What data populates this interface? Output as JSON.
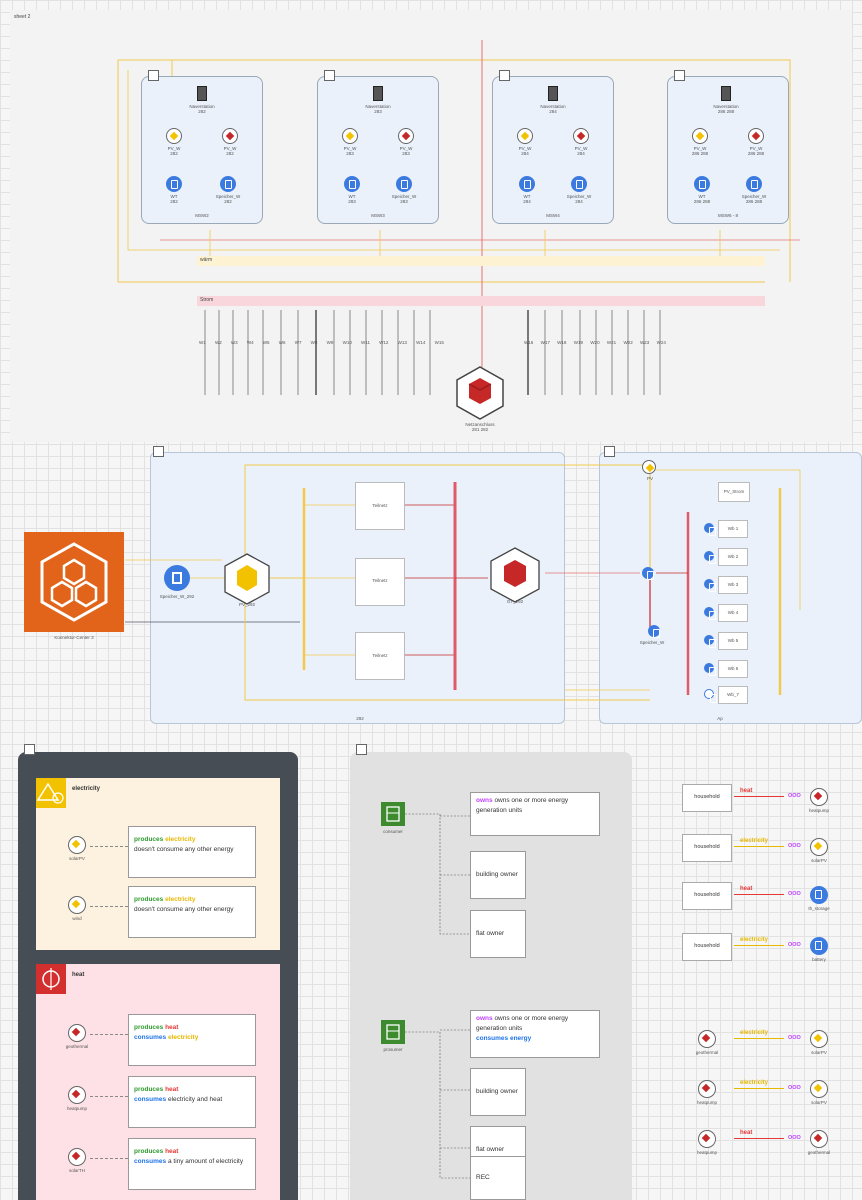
{
  "top": {
    "title": "sheet 2",
    "buildings": [
      {
        "rack": "Naverstation\n282",
        "pv": "PV_W\n282",
        "hp": "PV_W\n282",
        "inv": "WT\n282",
        "store": "Speicher_W\n282",
        "foot": "MSW2"
      },
      {
        "rack": "Naverstation\n283",
        "pv": "PV_W\n283",
        "hp": "PV_W\n283",
        "inv": "WT\n283",
        "store": "Speicher_W\n283",
        "foot": "MSW3"
      },
      {
        "rack": "Naverstation\n284",
        "pv": "PV_W\n284",
        "hp": "PV_W\n284",
        "inv": "WT\n284",
        "store": "Speicher_W\n284",
        "foot": "MSW4"
      },
      {
        "rack": "Naverstation\n286 288",
        "pv": "PV_W\n286 288",
        "hp": "PV_W\n286 288",
        "inv": "WT\n286 288",
        "store": "Speicher_W\n286 288",
        "foot": "MSW6 - 8"
      }
    ],
    "bus_yellow": "wärm",
    "bus_pink": "Strom",
    "center_label": "Netzanschluss\n281 282",
    "feeder_nums_left": [
      "W1",
      "W2",
      "W3",
      "W4",
      "W5",
      "W6",
      "W7",
      "W8",
      "W9",
      "W10",
      "W11",
      "W12",
      "W13",
      "W14",
      "W15"
    ],
    "feeder_nums_right": [
      "W16",
      "W17",
      "W18",
      "W19",
      "W20",
      "W21",
      "W22",
      "W23",
      "W24"
    ]
  },
  "middle": {
    "orange_label": "Konnektor-Center 3",
    "storage_label": "Speicher_W_292",
    "hub_label": "PV_292",
    "boxes": [
      "Teilnetz",
      "Teilnetz",
      "Teilnetz"
    ],
    "red_hub_label": "GT_292",
    "right_top_label": "PV_Strom",
    "right_items": [
      "Wb 1",
      "Wb 2",
      "Wb 3",
      "Wb 4",
      "Wb 5",
      "Wb 6"
    ],
    "right_bottom": "Wb_7",
    "bottom_left_label": "292",
    "bottom_right_label": "Ap",
    "left_hub_label": "Speicher_W"
  },
  "legend": {
    "electricity": "electricity",
    "heat": "heat",
    "items": [
      {
        "name": "solarPV",
        "produces": "electricity",
        "consumes": "doesn't consume any other energy"
      },
      {
        "name": "wind",
        "produces": "electricity",
        "consumes": "doesn't consume any other energy"
      },
      {
        "name": "geothermal",
        "produces": "heat",
        "consumes": "electricity"
      },
      {
        "name": "heatpump",
        "produces": "heat",
        "consumes": "electricity and heat"
      },
      {
        "name": "solarTH",
        "produces": "heat",
        "consumes": "a tiny amount of electricity"
      }
    ]
  },
  "roles": {
    "consumer": "consumer",
    "prosumer": "prosumer",
    "consumer_desc": "owns one or more energy generation units",
    "prosumer_desc": "owns one or more energy generation units",
    "prosumer_desc2": "consumes energy",
    "branches1": [
      "building owner",
      "flat owner"
    ],
    "branches2": [
      "building owner",
      "flat owner",
      "REC"
    ]
  },
  "flows": [
    {
      "from": "household",
      "energy": "heat",
      "to": "heatpump"
    },
    {
      "from": "household",
      "energy": "electricity",
      "to": "solarPV"
    },
    {
      "from": "household",
      "energy": "heat",
      "to": "th_storage"
    },
    {
      "from": "household",
      "energy": "electricity",
      "to": "battery"
    },
    {
      "from": "geothermal",
      "energy": "electricity",
      "to": "solarPV"
    },
    {
      "from": "heatpump",
      "energy": "electricity",
      "to": "solarPV"
    },
    {
      "from": "heatpump",
      "energy": "heat",
      "to": "geothermal"
    }
  ],
  "flow_connector": "OOO",
  "colors": {
    "electricity": "#e6b800",
    "heat": "#e53935",
    "consume": "#1e73e8",
    "own": "#c040ff",
    "orange": "#e2641b",
    "green": "#3d8b2e",
    "dark": "#474d54"
  }
}
